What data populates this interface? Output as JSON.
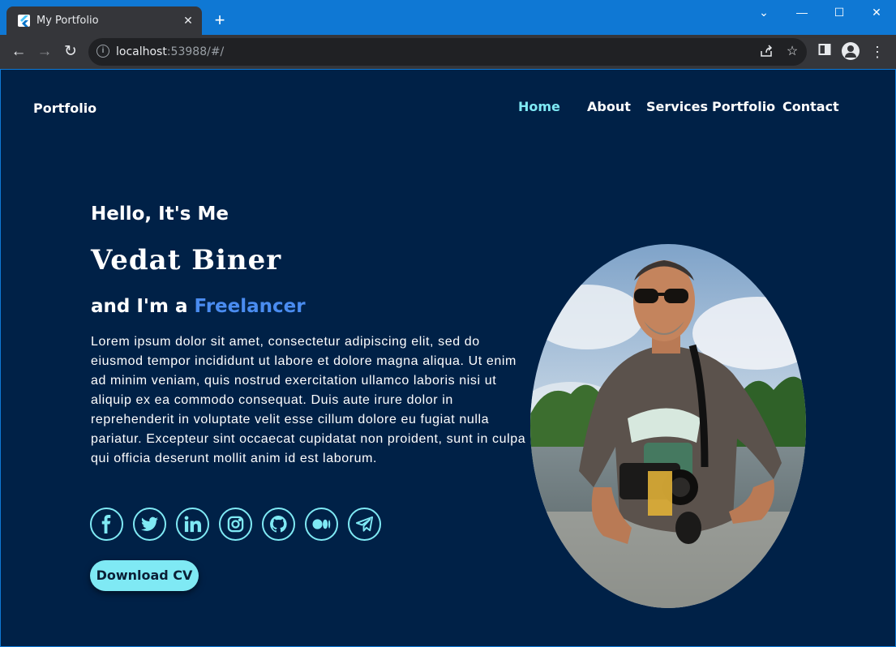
{
  "browser": {
    "tab_title": "My Portfolio",
    "close_glyph": "✕",
    "new_tab_glyph": "+",
    "url_host": "localhost",
    "url_rest": ":53988/#/",
    "window_controls": {
      "dropdown": "⌄",
      "minimize": "—",
      "maximize": "☐",
      "close": "✕"
    }
  },
  "site": {
    "brand": "Portfolio",
    "nav": [
      "Home",
      "About",
      "Services",
      "Portfolio",
      "Contact"
    ],
    "active_nav": "Home"
  },
  "hero": {
    "greeting": "Hello, It's Me",
    "name": "Vedat Biner",
    "role_prefix": "and I'm a ",
    "role": "Freelancer",
    "description": "Lorem ipsum dolor sit amet, consectetur adipiscing elit, sed do eiusmod tempor incididunt ut labore et dolore magna aliqua. Ut enim ad minim veniam, quis nostrud exercitation ullamco laboris nisi ut aliquip ex ea commodo consequat. Duis aute irure dolor in reprehenderit in voluptate velit esse cillum dolore eu fugiat nulla pariatur. Excepteur sint occaecat cupidatat non proident, sunt in culpa qui officia deserunt mollit anim id est laborum.",
    "socials": [
      "facebook-icon",
      "twitter-icon",
      "linkedin-icon",
      "instagram-icon",
      "github-icon",
      "medium-icon",
      "telegram-icon"
    ],
    "cta": "Download CV"
  },
  "colors": {
    "page_bg": "#002147",
    "accent": "#7fe9f4",
    "role_highlight": "#4a8cf0",
    "chrome_blue": "#0f78d4"
  }
}
